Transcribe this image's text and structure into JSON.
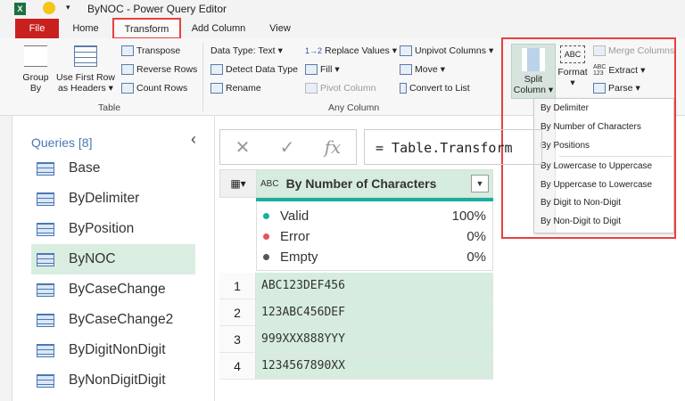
{
  "window": {
    "title": "ByNOC - Power Query Editor",
    "app_icon": "excel-icon"
  },
  "tabs": [
    "File",
    "Home",
    "Transform",
    "Add Column",
    "View"
  ],
  "ribbon": {
    "table_group": {
      "label": "Table",
      "group_by": "Group By",
      "group_by_l1": "Group",
      "group_by_l2": "By",
      "first_row_l1": "Use First Row",
      "first_row_l2": "as Headers",
      "transpose": "Transpose",
      "reverse_rows": "Reverse Rows",
      "count_rows": "Count Rows"
    },
    "any_column_group": {
      "label": "Any Column",
      "data_type": "Data Type: Text",
      "detect": "Detect Data Type",
      "rename": "Rename",
      "replace": "Replace Values",
      "fill": "Fill",
      "pivot": "Pivot Column",
      "unpivot": "Unpivot Columns",
      "move": "Move",
      "convert": "Convert to List"
    },
    "text_group": {
      "split_l1": "Split",
      "split_l2": "Column",
      "format": "Format",
      "merge": "Merge Columns",
      "extract": "Extract",
      "parse": "Parse"
    }
  },
  "split_menu": [
    "By Delimiter",
    "By Number of Characters",
    "By Positions",
    "By Lowercase to Uppercase",
    "By Uppercase to Lowercase",
    "By Digit to Non-Digit",
    "By Non-Digit to Digit"
  ],
  "queries": {
    "header": "Queries [8]",
    "items": [
      "Base",
      "ByDelimiter",
      "ByPosition",
      "ByNOC",
      "ByCaseChange",
      "ByCaseChange2",
      "ByDigitNonDigit",
      "ByNonDigitDigit"
    ],
    "selected": "ByNOC"
  },
  "formula": {
    "text": "= Table.Transform",
    "cancel": "✕",
    "confirm": "✓",
    "fx": "fx"
  },
  "table": {
    "column": "By Number of Characters",
    "type_icon": "ABC",
    "stats": [
      {
        "label": "Valid",
        "pct": "100%",
        "color": "#1aae9f"
      },
      {
        "label": "Error",
        "pct": "0%",
        "color": "#e8535a"
      },
      {
        "label": "Empty",
        "pct": "0%",
        "color": "#555555"
      }
    ],
    "rows": [
      {
        "n": "1",
        "v": "ABC123DEF456"
      },
      {
        "n": "2",
        "v": "123ABC456DEF"
      },
      {
        "n": "3",
        "v": "999XXX888YYY"
      },
      {
        "n": "4",
        "v": "1234567890XX"
      }
    ]
  },
  "colors": {
    "file_tab": "#c8201f",
    "highlight": "#e8403f",
    "accent": "#1aae9f",
    "row_bg": "#d6ecdf"
  }
}
